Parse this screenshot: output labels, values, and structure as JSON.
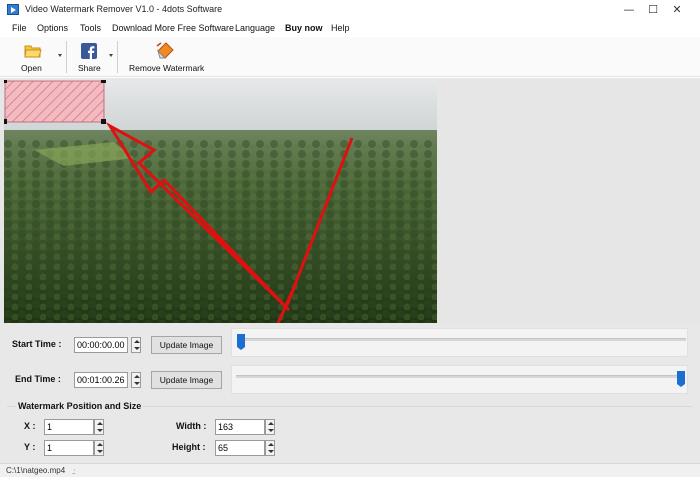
{
  "window": {
    "title": "Video Watermark Remover V1.0 - 4dots Software",
    "minimize_glyph": "—",
    "maximize_glyph": "☐",
    "close_glyph": "✕"
  },
  "menu": {
    "items": [
      "File",
      "Options",
      "Tools",
      "Download More Free Software",
      "Language",
      "Buy now",
      "Help"
    ]
  },
  "toolbar": {
    "open_label": "Open",
    "share_label": "Share",
    "remove_label": "Remove Watermark",
    "icons": {
      "open": "folder-icon",
      "share": "facebook-icon",
      "remove": "eraser-icon"
    }
  },
  "timing": {
    "start_label": "Start Time :",
    "start_value": "00:00:00.00",
    "end_label": "End Time :",
    "end_value": "00:01:00.26",
    "update_label": "Update Image",
    "start_slider_fraction": 0.0,
    "end_slider_fraction": 1.0
  },
  "watermark": {
    "section_title": "Watermark Position and Size",
    "x_label": "X :",
    "x_value": "1",
    "y_label": "Y :",
    "y_value": "1",
    "width_label": "Width :",
    "width_value": "163",
    "height_label": "Height :",
    "height_value": "65"
  },
  "status": {
    "path": "C:\\1\\natgeo.mp4"
  },
  "colors": {
    "selection_fill": "#f4b8c0",
    "selection_hatch": "#e07a88",
    "arrow": "#e01010",
    "slider_thumb": "#1a6fd0"
  }
}
